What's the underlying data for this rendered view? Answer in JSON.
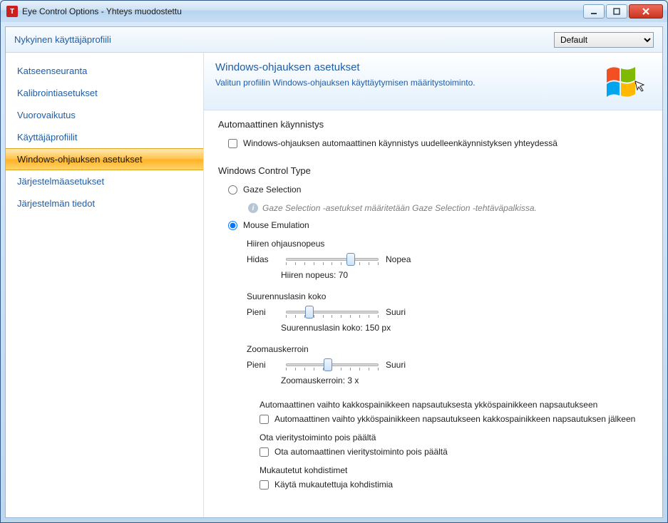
{
  "titlebar": {
    "title": "Eye Control Options - Yhteys muodostettu"
  },
  "profile": {
    "label": "Nykyinen käyttäjäprofiili",
    "selected": "Default"
  },
  "sidebar": {
    "items": [
      {
        "label": "Katseenseuranta"
      },
      {
        "label": "Kalibrointiasetukset"
      },
      {
        "label": "Vuorovaikutus"
      },
      {
        "label": "Käyttäjäprofiilit"
      },
      {
        "label": "Windows-ohjauksen asetukset"
      },
      {
        "label": "Järjestelmäasetukset"
      },
      {
        "label": "Järjestelmän tiedot"
      }
    ],
    "selected_index": 4
  },
  "page": {
    "title": "Windows-ohjauksen asetukset",
    "desc": "Valitun profiilin Windows-ohjauksen käyttäytymisen määritystoiminto."
  },
  "autostart": {
    "heading": "Automaattinen käynnistys",
    "checkbox_label": "Windows-ohjauksen automaattinen käynnistys uudelleenkäynnistyksen yhteydessä"
  },
  "controltype": {
    "heading": "Windows Control Type",
    "gaze_label": "Gaze Selection",
    "gaze_note": "Gaze Selection -asetukset määritetään Gaze Selection -tehtäväpalkissa.",
    "mouse_label": "Mouse Emulation"
  },
  "mouse": {
    "speed": {
      "pname": "Hiiren ohjausnopeus",
      "min": "Hidas",
      "max": "Nopea",
      "value_label": "Hiiren nopeus: 70",
      "pos_pct": 70
    },
    "mag": {
      "pname": "Suurennuslasin koko",
      "min": "Pieni",
      "max": "Suuri",
      "value_label": "Suurennuslasin koko: 150 px",
      "pos_pct": 25
    },
    "zoom": {
      "pname": "Zoomauskerroin",
      "min": "Pieni",
      "max": "Suuri",
      "value_label": "Zoomauskerroin: 3 x",
      "pos_pct": 45
    },
    "autoswitch_heading": "Automaattinen vaihto kakkospainikkeen napsautuksesta ykköspainikkeen napsautukseen",
    "autoswitch_cb": "Automaattinen vaihto ykköspainikkeen napsautukseen kakkospainikkeen napsautuksen jälkeen",
    "scrolloff_heading": "Ota vieritystoiminto pois päältä",
    "scrolloff_cb": "Ota automaattinen vieritystoiminto pois päältä",
    "cursors_heading": "Mukautetut kohdistimet",
    "cursors_cb": "Käytä mukautettuja kohdistimia"
  }
}
